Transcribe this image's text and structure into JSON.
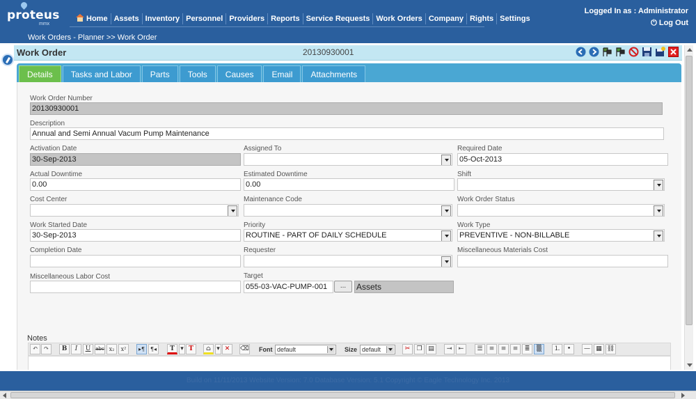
{
  "header": {
    "logo_text": "proteus",
    "logo_sub": "mmx",
    "nav": [
      "Home",
      "Assets",
      "Inventory",
      "Personnel",
      "Providers",
      "Reports",
      "Service Requests",
      "Work Orders",
      "Company",
      "Rights",
      "Settings"
    ],
    "login_text": "Logged In as : Administrator",
    "logout_label": "Log Out",
    "breadcrumb": "Work Orders - Planner >> Work Order"
  },
  "work_order": {
    "title": "Work Order",
    "number": "20130930001"
  },
  "toolbar_icons": [
    "prev-icon",
    "next-icon",
    "flags-icon",
    "flags-icon",
    "cancel-icon",
    "save-icon",
    "save-new-icon",
    "close-icon"
  ],
  "tabs": [
    "Details",
    "Tasks and Labor",
    "Parts",
    "Tools",
    "Causes",
    "Email",
    "Attachments"
  ],
  "active_tab": "Details",
  "form": {
    "work_order_number": {
      "label": "Work Order Number",
      "value": "20130930001"
    },
    "description": {
      "label": "Description",
      "value": "Annual and Semi Annual Vacum Pump Maintenance"
    },
    "activation_date": {
      "label": "Activation Date",
      "value": "30-Sep-2013"
    },
    "assigned_to": {
      "label": "Assigned To",
      "value": ""
    },
    "required_date": {
      "label": "Required Date",
      "value": "05-Oct-2013"
    },
    "actual_downtime": {
      "label": "Actual Downtime",
      "value": "0.00"
    },
    "estimated_downtime": {
      "label": "Estimated Downtime",
      "value": "0.00"
    },
    "shift": {
      "label": "Shift",
      "value": ""
    },
    "cost_center": {
      "label": "Cost Center",
      "value": ""
    },
    "maintenance_code": {
      "label": "Maintenance Code",
      "value": ""
    },
    "work_order_status": {
      "label": "Work Order Status",
      "value": ""
    },
    "work_started_date": {
      "label": "Work Started Date",
      "value": "30-Sep-2013"
    },
    "priority": {
      "label": "Priority",
      "value": "ROUTINE - PART OF DAILY SCHEDULE"
    },
    "work_type": {
      "label": "Work Type",
      "value": "PREVENTIVE - NON-BILLABLE"
    },
    "completion_date": {
      "label": "Completion Date",
      "value": ""
    },
    "requester": {
      "label": "Requester",
      "value": ""
    },
    "misc_materials_cost": {
      "label": "Miscellaneous Materials Cost",
      "value": ""
    },
    "misc_labor_cost": {
      "label": "Miscellaneous Labor Cost",
      "value": ""
    },
    "target": {
      "label": "Target",
      "value": "055-03-VAC-PUMP-001",
      "browse": "...",
      "type_value": "Assets"
    }
  },
  "notes": {
    "label": "Notes",
    "font_label": "Font",
    "font_value": "default",
    "size_label": "Size",
    "size_value": "default"
  },
  "footer_text": "Build on 11/11/2013 Website Version: 7.0 Database Version: 5.1 Copyright © Eagle Technology Inc. 2013"
}
